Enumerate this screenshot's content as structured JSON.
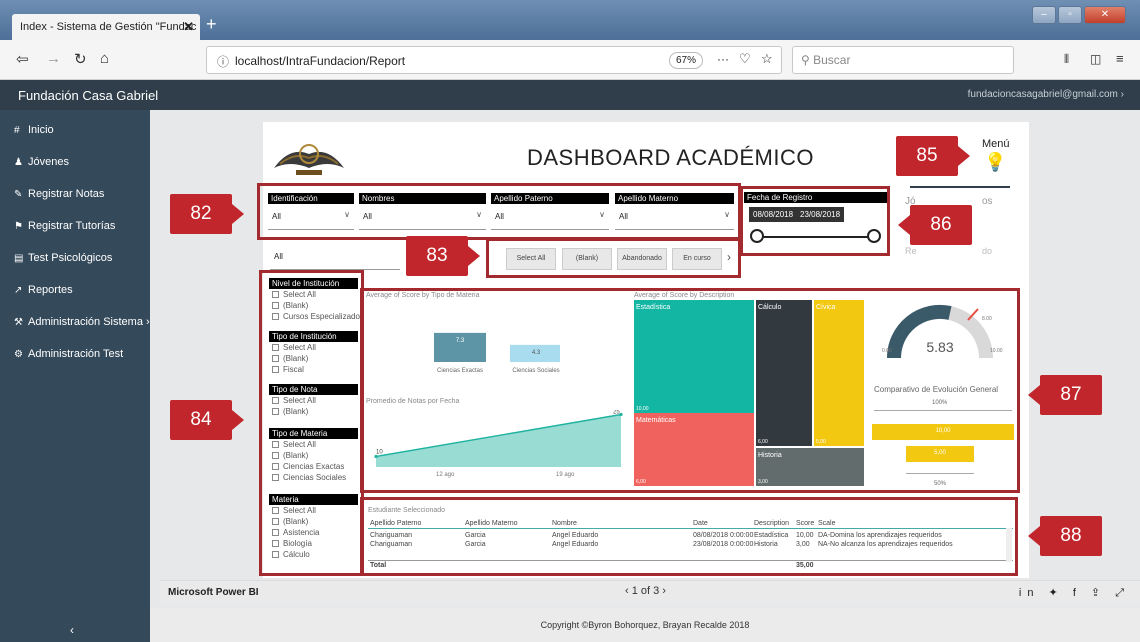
{
  "browser": {
    "tab_title": "Index - Sistema de Gestión \"Fundac",
    "tab_close": "✕",
    "new_tab": "+",
    "url_info": "ⓘ",
    "url": "localhost/IntraFundacion/Report",
    "zoom": "67%",
    "dots": "···",
    "search_placeholder": "Buscar",
    "win_min": "–",
    "win_max": "▫",
    "win_close": "✕"
  },
  "app": {
    "brand": "Fundación Casa Gabriel",
    "user_email": "fundacioncasagabriel@gmail.com  ›",
    "sidebar": [
      {
        "label": "Inicio",
        "icon": "#"
      },
      {
        "label": "Jóvenes",
        "icon": "♟"
      },
      {
        "label": "Registrar Notas",
        "icon": "✎"
      },
      {
        "label": "Registrar Tutorías",
        "icon": "⚑"
      },
      {
        "label": "Test Psicológicos",
        "icon": "▤"
      },
      {
        "label": "Reportes",
        "icon": "↗"
      },
      {
        "label": "Administración Sistema  ›",
        "icon": "⚒"
      },
      {
        "label": "Administración Test",
        "icon": "⚙"
      }
    ],
    "collapse": "‹",
    "copyright": "Copyright ©Byron Bohorquez, Brayan Recalde 2018"
  },
  "pbi": {
    "brand": "Microsoft Power BI",
    "pager": "‹   1 of 3   ›",
    "share_icons": "in ✦ f ⇪ ⤢"
  },
  "report": {
    "title": "DASHBOARD ACADÉMICO",
    "menu": "Menú",
    "slicers": [
      {
        "header": "Identificación",
        "value": "All"
      },
      {
        "header": "Nombres",
        "value": "All"
      },
      {
        "header": "Apellido Paterno",
        "value": "All"
      },
      {
        "header": "Apellido Materno",
        "value": "All"
      }
    ],
    "second_slicer_value": "All",
    "fecha": {
      "header": "Fecha de Registro",
      "from": "08/08/2018",
      "to": "23/08/2018"
    },
    "status_buttons": [
      "Select All",
      "(Blank)",
      "Abandonado",
      "En curso"
    ],
    "status_next": "›",
    "lists": [
      {
        "header": "Nivel de Institución",
        "items": [
          "Select All",
          "(Blank)",
          "Cursos Especializados"
        ]
      },
      {
        "header": "Tipo de Institución",
        "items": [
          "Select All",
          "(Blank)",
          "Fiscal"
        ]
      },
      {
        "header": "Tipo de Nota",
        "items": [
          "Select All",
          "(Blank)"
        ]
      },
      {
        "header": "Tipo de Materia",
        "items": [
          "Select All",
          "(Blank)",
          "Ciencias Exactas",
          "Ciencias Sociales"
        ]
      },
      {
        "header": "Materia",
        "items": [
          "Select All",
          "(Blank)",
          "Asistencia",
          "Biología",
          "Cálculo"
        ]
      }
    ],
    "bar_title": "Average of Score by Tipo de Materia",
    "line_title": "Promedio de Notas por Fecha",
    "tree_title": "Average of Score by Description",
    "gauge": {
      "value": "5.83",
      "min": "0.00",
      "max": "10.00",
      "target": "8.00"
    },
    "compare_title": "Comparativo de Evolución  General",
    "compare_top": "100%",
    "compare_bottom": "50%",
    "compare_bars": [
      "10,00",
      "5,00"
    ],
    "partial_labels": [
      "Jó",
      "os",
      "Re",
      "do"
    ],
    "table_title": "Estudiante Seleccionado",
    "table_headers": [
      "Apellido Paterno",
      "Apellido Materno",
      "Nombre",
      "Date",
      "Description",
      "Score",
      "Scale"
    ],
    "table_rows": [
      [
        "Chariguaman",
        "Garcia",
        "Angel Eduardo",
        "08/08/2018 0:00:00",
        "Estadística",
        "10,00",
        "DA-Domina los aprendizajes requeridos"
      ],
      [
        "Chariguaman",
        "Garcia",
        "Angel Eduardo",
        "23/08/2018 0:00:00",
        "Historia",
        "3,00",
        "NA-No alcanza los aprendizajes requeridos"
      ]
    ],
    "table_total_label": "Total",
    "table_total_value": "35,00"
  },
  "chart_data": [
    {
      "type": "bar",
      "title": "Average of Score by Tipo de Materia",
      "categories": [
        "Ciencias Exactas",
        "Ciencias Sociales"
      ],
      "values": [
        7.3,
        4.3
      ],
      "colors": [
        "#5e95a6",
        "#a9dcef"
      ]
    },
    {
      "type": "area",
      "title": "Promedio de Notas por Fecha",
      "x": [
        "12 ago",
        "19 ago"
      ],
      "start_label": "10",
      "end_label": "25",
      "values": [
        10,
        25
      ],
      "color": "#7fd3c8"
    },
    {
      "type": "heatmap",
      "title": "Average of Score by Description",
      "cells": [
        {
          "name": "Estadística",
          "value": "10,00",
          "color": "#12b6a3"
        },
        {
          "name": "Matemáticas",
          "value": "6,00",
          "color": "#f0625d"
        },
        {
          "name": "Cálculo",
          "value": "6,00",
          "color": "#333a3f"
        },
        {
          "name": "Cívica",
          "value": "5,00",
          "color": "#f2c811"
        },
        {
          "name": "Historia",
          "value": "3,00",
          "color": "#636c6d"
        }
      ]
    }
  ],
  "callouts": [
    "82",
    "83",
    "84",
    "85",
    "86",
    "87",
    "88"
  ],
  "colors": {
    "sidebar": "#34495a",
    "header": "#2f3e4a",
    "accent": "#c0262b"
  }
}
